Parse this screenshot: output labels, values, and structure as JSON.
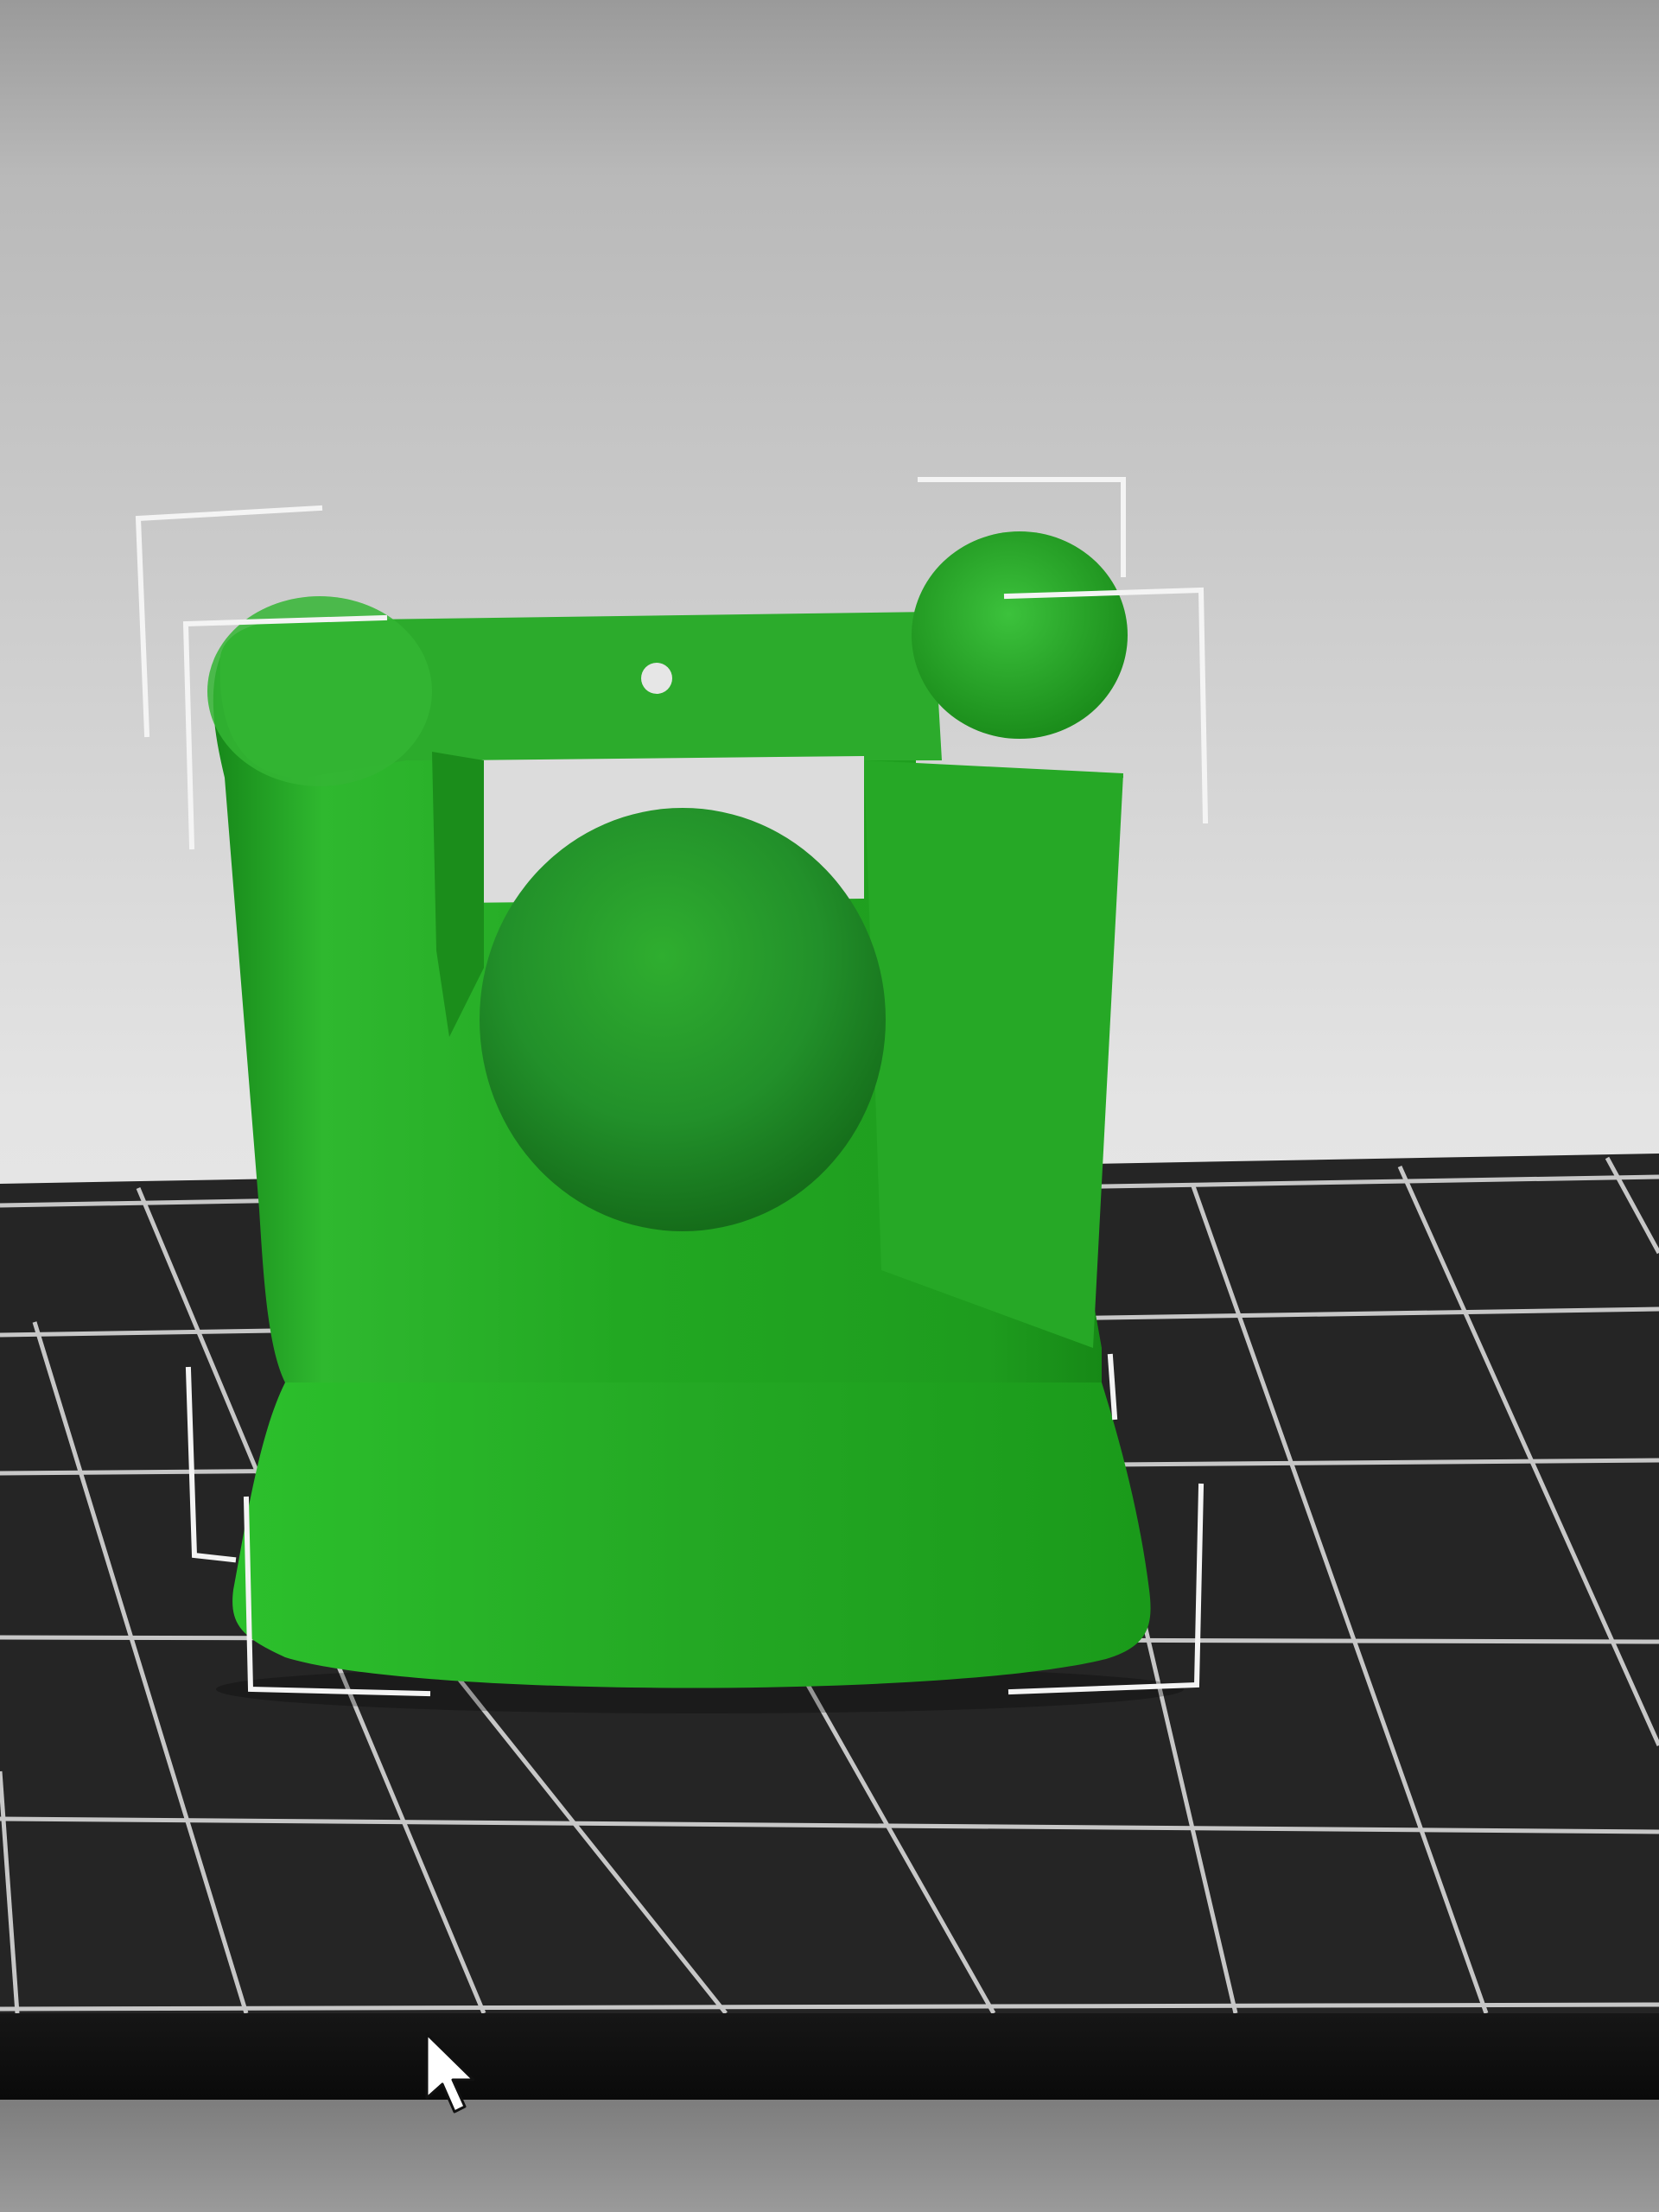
{
  "app": {
    "view": "3d-build-plate-viewport"
  },
  "colors": {
    "background_top": "#9e9e9e",
    "background_bottom": "#f1f1f1",
    "build_plate": "#262626",
    "grid_lines": "#d4d4d4",
    "model_green": "#22a622",
    "model_green_light": "#4fd24f",
    "model_green_dark": "#147a14",
    "selection_brackets": "#f5f5f5"
  },
  "icons": {
    "cursor": "mouse-pointer-icon"
  },
  "model": {
    "name": "",
    "selected": true
  }
}
